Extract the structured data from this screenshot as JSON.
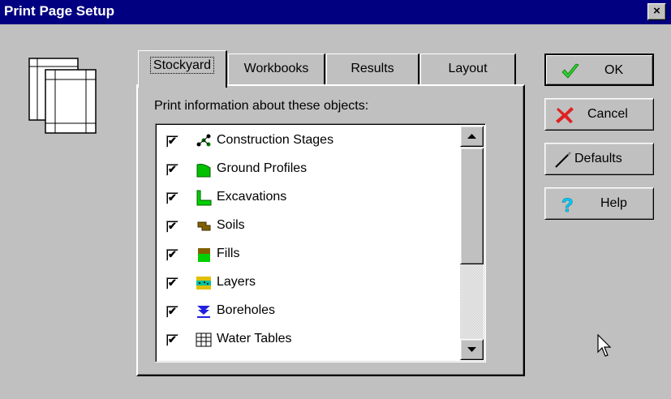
{
  "window": {
    "title": "Print Page Setup",
    "close_label": "×"
  },
  "tabs": [
    {
      "label": "Stockyard",
      "active": true
    },
    {
      "label": "Workbooks",
      "active": false
    },
    {
      "label": "Results",
      "active": false
    },
    {
      "label": "Layout",
      "active": false
    }
  ],
  "panel": {
    "label": "Print information about these objects:"
  },
  "objects": [
    {
      "label": "Construction Stages",
      "checked": true,
      "icon": "construction-stages-icon"
    },
    {
      "label": "Ground Profiles",
      "checked": true,
      "icon": "ground-profiles-icon"
    },
    {
      "label": "Excavations",
      "checked": true,
      "icon": "excavations-icon"
    },
    {
      "label": "Soils",
      "checked": true,
      "icon": "soils-icon"
    },
    {
      "label": "Fills",
      "checked": true,
      "icon": "fills-icon"
    },
    {
      "label": "Layers",
      "checked": true,
      "icon": "layers-icon"
    },
    {
      "label": "Boreholes",
      "checked": true,
      "icon": "boreholes-icon"
    },
    {
      "label": "Water Tables",
      "checked": true,
      "icon": "water-tables-icon"
    }
  ],
  "checkmark": "✔",
  "buttons": {
    "ok": "OK",
    "cancel": "Cancel",
    "defaults": "Defaults",
    "help": "Help"
  },
  "colors": {
    "titlebar": "#000080",
    "dialog": "#c0c0c0",
    "ok_check": "#33cc33",
    "cancel_x": "#e02020",
    "help_mark": "#00ccff"
  }
}
